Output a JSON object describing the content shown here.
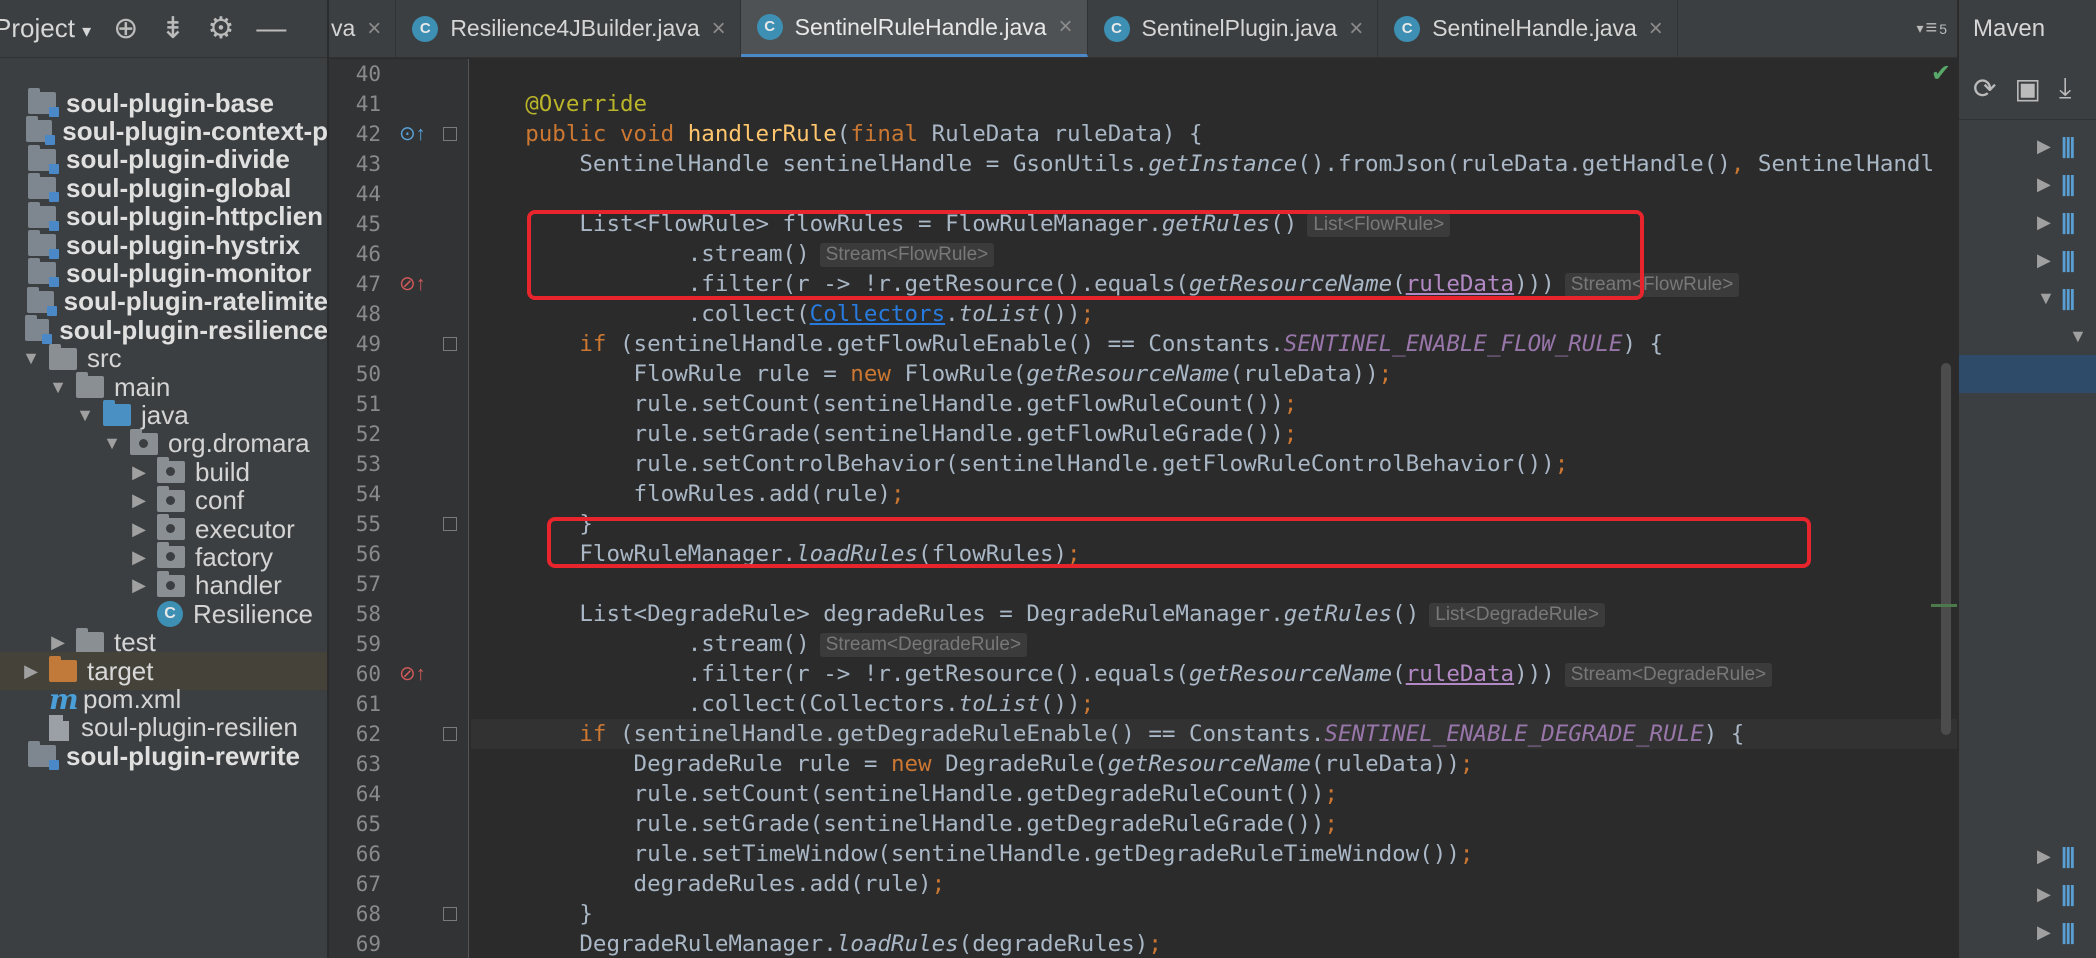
{
  "sidebar": {
    "title": "Project",
    "tree": [
      {
        "label": "soul-plugin-base",
        "indent": 0,
        "type": "module",
        "bold": true,
        "arrow": ""
      },
      {
        "label": "soul-plugin-context-p",
        "indent": 0,
        "type": "module",
        "bold": true,
        "arrow": ""
      },
      {
        "label": "soul-plugin-divide",
        "indent": 0,
        "type": "module",
        "bold": true,
        "arrow": ""
      },
      {
        "label": "soul-plugin-global",
        "indent": 0,
        "type": "module",
        "bold": true,
        "arrow": ""
      },
      {
        "label": "soul-plugin-httpclien",
        "indent": 0,
        "type": "module",
        "bold": true,
        "arrow": ""
      },
      {
        "label": "soul-plugin-hystrix",
        "indent": 0,
        "type": "module",
        "bold": true,
        "arrow": ""
      },
      {
        "label": "soul-plugin-monitor",
        "indent": 0,
        "type": "module",
        "bold": true,
        "arrow": ""
      },
      {
        "label": "soul-plugin-ratelimite",
        "indent": 0,
        "type": "module",
        "bold": true,
        "arrow": ""
      },
      {
        "label": "soul-plugin-resilience",
        "indent": 0,
        "type": "module",
        "bold": true,
        "arrow": ""
      },
      {
        "label": "src",
        "indent": 1,
        "type": "folder",
        "bold": false,
        "arrow": "down"
      },
      {
        "label": "main",
        "indent": 2,
        "type": "folder",
        "bold": false,
        "arrow": "down"
      },
      {
        "label": "java",
        "indent": 3,
        "type": "folder-blue",
        "bold": false,
        "arrow": "down"
      },
      {
        "label": "org.dromara",
        "indent": 4,
        "type": "package",
        "bold": false,
        "arrow": "down"
      },
      {
        "label": "build",
        "indent": 5,
        "type": "package",
        "bold": false,
        "arrow": "right"
      },
      {
        "label": "conf",
        "indent": 5,
        "type": "package",
        "bold": false,
        "arrow": "right"
      },
      {
        "label": "executor",
        "indent": 5,
        "type": "package",
        "bold": false,
        "arrow": "right"
      },
      {
        "label": "factory",
        "indent": 5,
        "type": "package",
        "bold": false,
        "arrow": "right"
      },
      {
        "label": "handler",
        "indent": 5,
        "type": "package",
        "bold": false,
        "arrow": "right"
      },
      {
        "label": "Resilience",
        "indent": 5,
        "type": "class",
        "bold": false,
        "arrow": ""
      },
      {
        "label": "test",
        "indent": 2,
        "type": "folder",
        "bold": false,
        "arrow": "right"
      },
      {
        "label": "target",
        "indent": 1,
        "type": "folder-orange",
        "bold": false,
        "arrow": "right"
      },
      {
        "label": "pom.xml",
        "indent": 1,
        "type": "maven",
        "bold": false,
        "arrow": ""
      },
      {
        "label": "soul-plugin-resilien",
        "indent": 1,
        "type": "file",
        "bold": false,
        "arrow": ""
      },
      {
        "label": "soul-plugin-rewrite",
        "indent": 0,
        "type": "module",
        "bold": true,
        "arrow": ""
      }
    ]
  },
  "tabs": [
    {
      "label": "va",
      "active": false,
      "icon": false
    },
    {
      "label": "Resilience4JBuilder.java",
      "active": false,
      "icon": true
    },
    {
      "label": "SentinelRuleHandle.java",
      "active": true,
      "icon": true
    },
    {
      "label": "SentinelPlugin.java",
      "active": false,
      "icon": true
    },
    {
      "label": "SentinelHandle.java",
      "active": false,
      "icon": true
    }
  ],
  "tab_overflow": "5",
  "maven": {
    "title": "Maven"
  },
  "icons": {
    "project_dropdown": "chevron-down-icon",
    "locate": "crosshair-icon",
    "collapse": "collapse-all-icon",
    "settings": "gear-icon",
    "hide": "minus-icon",
    "refresh": "refresh-icon",
    "reimport": "reimport-icon",
    "download": "download-icon",
    "inspection_ok": "checkmark-icon"
  },
  "editor": {
    "first_line": 40,
    "caret_line": 62,
    "highlight_color": "#e8242c",
    "lines": [
      {
        "n": 40,
        "html": ""
      },
      {
        "n": 41,
        "html": "    <span class='an'>@Override</span>"
      },
      {
        "n": 42,
        "html": "    <span class='k'>public void </span><span class='fn'>handlerRule</span>(<span class='k'>final </span>RuleData ruleData) {"
      },
      {
        "n": 43,
        "html": "        SentinelHandle sentinelHandle = GsonUtils.<span class='it'>getInstance</span>().fromJson(ruleData.getHandle()<span class='k'>, </span>SentinelHandl"
      },
      {
        "n": 44,
        "html": ""
      },
      {
        "n": 45,
        "html": "        List&lt;FlowRule&gt; flowRules = FlowRuleManager.<span class='it'>getRules</span>()<span class='hint'>List&lt;FlowRule&gt;</span>"
      },
      {
        "n": 46,
        "html": "                .stream()<span class='hint'>Stream&lt;FlowRule&gt;</span>"
      },
      {
        "n": 47,
        "html": "                .filter(r -&gt; !r.getResource().equals(<span class='it'>getResourceName</span>(<span class='pu'>ruleData</span>)))<span class='hint'>Stream&lt;FlowRule&gt;</span>"
      },
      {
        "n": 48,
        "html": "                .collect(<span class='un'>Collectors</span>.<span class='it'>toList</span>())<span class='k'>;</span>"
      },
      {
        "n": 49,
        "html": "        <span class='k'>if </span>(sentinelHandle.getFlowRuleEnable() == Constants.<span class='cs'>SENTINEL_ENABLE_FLOW_RULE</span>) {"
      },
      {
        "n": 50,
        "html": "            FlowRule rule = <span class='k'>new </span>FlowRule(<span class='it'>getResourceName</span>(ruleData))<span class='k'>;</span>"
      },
      {
        "n": 51,
        "html": "            rule.setCount(sentinelHandle.getFlowRuleCount())<span class='k'>;</span>"
      },
      {
        "n": 52,
        "html": "            rule.setGrade(sentinelHandle.getFlowRuleGrade())<span class='k'>;</span>"
      },
      {
        "n": 53,
        "html": "            rule.setControlBehavior(sentinelHandle.getFlowRuleControlBehavior())<span class='k'>;</span>"
      },
      {
        "n": 54,
        "html": "            flowRules.add(rule)<span class='k'>;</span>"
      },
      {
        "n": 55,
        "html": "        }"
      },
      {
        "n": 56,
        "html": "        FlowRuleManager.<span class='it'>loadRules</span>(flowRules)<span class='k'>;</span>"
      },
      {
        "n": 57,
        "html": ""
      },
      {
        "n": 58,
        "html": "        List&lt;DegradeRule&gt; degradeRules = DegradeRuleManager.<span class='it'>getRules</span>()<span class='hint'>List&lt;DegradeRule&gt;</span>"
      },
      {
        "n": 59,
        "html": "                .stream()<span class='hint'>Stream&lt;DegradeRule&gt;</span>"
      },
      {
        "n": 60,
        "html": "                .filter(r -&gt; !r.getResource().equals(<span class='it'>getResourceName</span>(<span class='pu'>ruleData</span>)))<span class='hint'>Stream&lt;DegradeRule&gt;</span>"
      },
      {
        "n": 61,
        "html": "                .collect(Collectors.<span class='it'>toList</span>())<span class='k'>;</span>"
      },
      {
        "n": 62,
        "html": "        <span class='k'>if </span>(sentinelHandle.getDegradeRuleEnable() == Constants.<span class='cs'>SENTINEL_ENABLE_DEGRADE_RULE</span>) {"
      },
      {
        "n": 63,
        "html": "            DegradeRule rule = <span class='k'>new </span>DegradeRule(<span class='it'>getResourceName</span>(ruleData))<span class='k'>;</span>"
      },
      {
        "n": 64,
        "html": "            rule.setCount(sentinelHandle.getDegradeRuleCount())<span class='k'>;</span>"
      },
      {
        "n": 65,
        "html": "            rule.setGrade(sentinelHandle.getDegradeRuleGrade())<span class='k'>;</span>"
      },
      {
        "n": 66,
        "html": "            rule.setTimeWindow(sentinelHandle.getDegradeRuleTimeWindow())<span class='k'>;</span>"
      },
      {
        "n": 67,
        "html": "            degradeRules.add(rule)<span class='k'>;</span>"
      },
      {
        "n": 68,
        "html": "        }"
      },
      {
        "n": 69,
        "html": "        DegradeRuleManager.<span class='it'>loadRules</span>(degradeRules)<span class='k'>;</span>"
      }
    ]
  }
}
